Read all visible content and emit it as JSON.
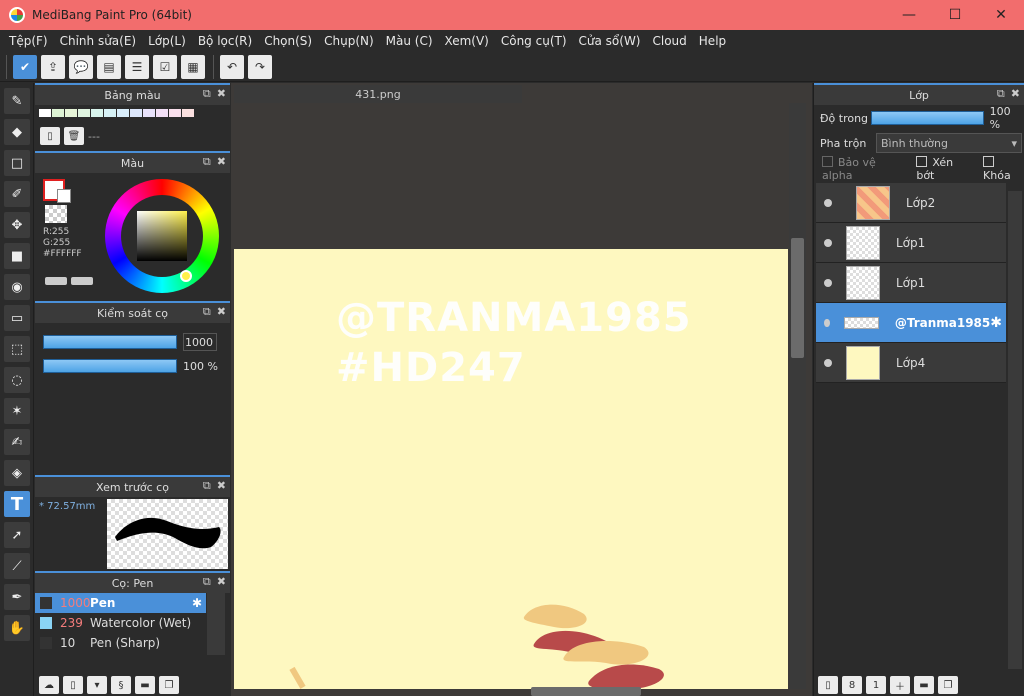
{
  "window": {
    "title": "MediBang Paint Pro (64bit)",
    "minimize": "—",
    "maximize": "☐",
    "close": "✕"
  },
  "menu": [
    "Tệp(F)",
    "Chỉnh sửa(E)",
    "Lớp(L)",
    "Bộ lọc(R)",
    "Chọn(S)",
    "Chụp(N)",
    "Màu (C)",
    "Xem(V)",
    "Công cụ(T)",
    "Cửa sổ(W)",
    "Cloud",
    "Help"
  ],
  "panels": {
    "palette": {
      "title": "Bảng màu",
      "swatch_label": "---"
    },
    "color": {
      "title": "Màu",
      "r": "R:255",
      "g": "G:255",
      "hex": "#FFFFFF"
    },
    "brush_control": {
      "title": "Kiểm soát cọ",
      "size": "1000",
      "opacity": "100 %"
    },
    "brush_preview": {
      "title": "Xem trước cọ",
      "size_label": "* 72.57mm"
    },
    "brush_list": {
      "title": "Cọ: Pen",
      "items": [
        {
          "size": "1000",
          "name": "Pen"
        },
        {
          "size": "239",
          "name": "Watercolor (Wet)"
        },
        {
          "size": "10",
          "name": "Pen (Sharp)"
        }
      ]
    }
  },
  "canvas": {
    "tab": "431.png",
    "watermark_line1": "@TRANMA1985",
    "watermark_line2": "#HD247"
  },
  "layers": {
    "title": "Lớp",
    "opacity_label": "Độ trong",
    "opacity_value": "100 %",
    "blend_label": "Pha trộn",
    "blend_value": "Bình thường",
    "protect_alpha": "Bảo vệ alpha",
    "clipping": "Xén bớt",
    "lock": "Khóa",
    "items": [
      {
        "name": "Lớp2"
      },
      {
        "name": "Lớp1"
      },
      {
        "name": "Lớp1"
      },
      {
        "name": "@Tranma1985"
      },
      {
        "name": "Lớp4"
      }
    ]
  },
  "colors": {
    "accent": "#4a90d9",
    "titlebar": "#f26d6d",
    "paper": "#fef8c0"
  }
}
